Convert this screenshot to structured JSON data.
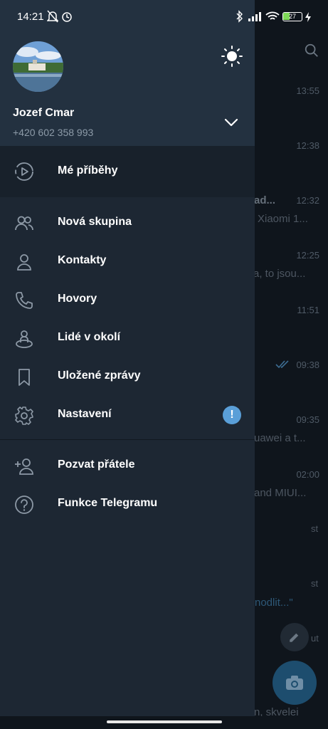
{
  "status_bar": {
    "time": "14:21",
    "battery": "27"
  },
  "background_list": {
    "times": [
      "13:55",
      "12:38",
      "12:32",
      "12:25",
      "11:51",
      "09:38",
      "09:35",
      "02:00"
    ],
    "fragments": [
      "ad...",
      "Xiaomi 1...",
      "a, to jsou...",
      "uawei a t...",
      "and MIUI...",
      "st",
      "st",
      "nodlit...\"",
      "ut",
      "n, skvelei"
    ]
  },
  "drawer": {
    "user": {
      "name": "Jozef Cmar",
      "phone": "+420 602 358 993"
    },
    "stories_label": "Mé příběhy",
    "items": [
      {
        "label": "Nová skupina",
        "icon": "group-icon"
      },
      {
        "label": "Kontakty",
        "icon": "person-icon"
      },
      {
        "label": "Hovory",
        "icon": "phone-icon"
      },
      {
        "label": "Lidé v okolí",
        "icon": "people-nearby-icon"
      },
      {
        "label": "Uložené zprávy",
        "icon": "bookmark-icon"
      },
      {
        "label": "Nastavení",
        "icon": "gear-icon",
        "badge": "!"
      }
    ],
    "extra_items": [
      {
        "label": "Pozvat přátele",
        "icon": "add-person-icon"
      },
      {
        "label": "Funkce Telegramu",
        "icon": "help-icon"
      }
    ]
  },
  "colors": {
    "drawer_bg": "#1d2733",
    "header_bg": "#233140",
    "badge": "#5a9fd8",
    "fab": "#1d4d6e"
  }
}
